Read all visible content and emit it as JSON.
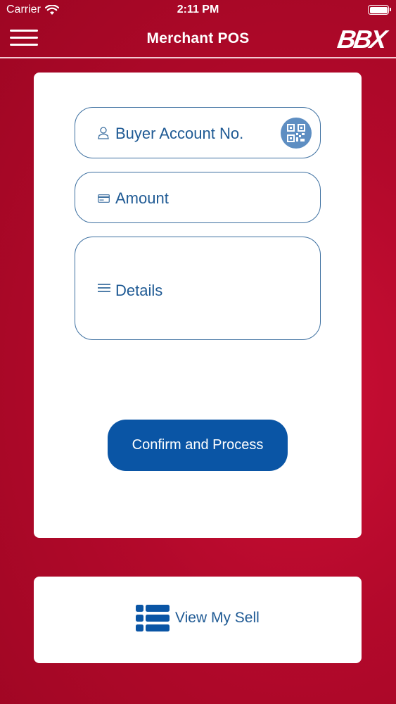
{
  "status_bar": {
    "carrier": "Carrier",
    "time": "2:11 PM"
  },
  "nav": {
    "title": "Merchant POS",
    "logo": "BBX",
    "menu_icon": "hamburger-menu-icon"
  },
  "form": {
    "buyer_account_placeholder": "Buyer Account No.",
    "amount_placeholder": "Amount",
    "details_placeholder": "Details",
    "confirm_label": "Confirm and Process",
    "icons": [
      "person-icon",
      "card-icon",
      "lines-icon",
      "qr-code-icon"
    ]
  },
  "footer": {
    "view_sell_label": "View My Sell",
    "icon": "list-icon"
  },
  "colors": {
    "background": "#b3092b",
    "accent": "#0a55a5",
    "field_border": "#3c6fa0",
    "text_blue": "#1f5a94",
    "qr_circle": "#5e8ec2"
  }
}
